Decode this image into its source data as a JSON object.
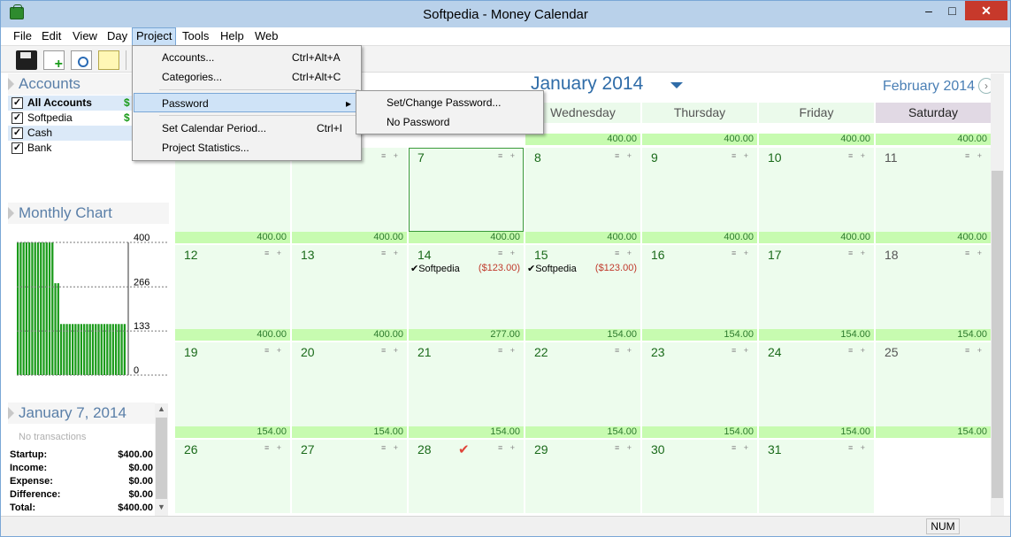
{
  "window": {
    "title": "Softpedia - Money Calendar",
    "min": "–",
    "max": "□",
    "close": "✕"
  },
  "menu": [
    "File",
    "Edit",
    "View",
    "Day",
    "Project",
    "Tools",
    "Help",
    "Web"
  ],
  "project_menu": {
    "items": [
      {
        "label": "Accounts...",
        "shortcut": "Ctrl+Alt+A"
      },
      {
        "label": "Categories...",
        "shortcut": "Ctrl+Alt+C"
      },
      {
        "label": "Password",
        "shortcut": "▸"
      },
      {
        "label": "Set Calendar Period...",
        "shortcut": "Ctrl+I"
      },
      {
        "label": "Project Statistics...",
        "shortcut": ""
      }
    ],
    "password_submenu": [
      "Set/Change Password...",
      "No Password"
    ]
  },
  "accounts": {
    "header": "Accounts",
    "items": [
      {
        "label": "All Accounts",
        "amount": "$",
        "checked": "✓"
      },
      {
        "label": "Softpedia",
        "amount": "$",
        "checked": "✓"
      },
      {
        "label": "Cash",
        "amount": "",
        "checked": "✓"
      },
      {
        "label": "Bank",
        "amount": "",
        "checked": "✓"
      }
    ]
  },
  "monthly_chart": {
    "header": "Monthly Chart",
    "y_ticks": [
      "400",
      "266",
      "133",
      "0"
    ],
    "chart_data": {
      "type": "bar",
      "values": [
        400,
        400,
        400,
        400,
        400,
        400,
        400,
        400,
        400,
        400,
        400,
        400,
        400,
        277,
        277,
        154,
        154,
        154,
        154,
        154,
        154,
        154,
        154,
        154,
        154,
        154,
        154,
        154,
        154,
        154,
        154,
        154,
        154,
        154,
        154,
        154,
        154,
        154
      ],
      "ylim": [
        0,
        400
      ],
      "yticks": [
        400,
        266,
        133,
        0
      ],
      "color": "#1a9b1a"
    }
  },
  "day_detail": {
    "header": "January 7, 2014",
    "no_transactions": "No transactions",
    "rows": [
      {
        "label": "Startup:",
        "value": "$400.00"
      },
      {
        "label": "Income:",
        "value": "$0.00"
      },
      {
        "label": "Expense:",
        "value": "$0.00"
      },
      {
        "label": "Difference:",
        "value": "$0.00"
      },
      {
        "label": "Total:",
        "value": "$400.00"
      }
    ]
  },
  "calendar": {
    "month": "January 2014",
    "next_month": "February 2014",
    "next_icon": "›",
    "days": [
      "Wednesday",
      "Thursday",
      "Friday",
      "Saturday"
    ],
    "week1_balances": [
      "400.00",
      "400.00",
      "400.00",
      "400.00"
    ],
    "weeks": [
      {
        "cells": [
          {
            "num": "",
            "bal": "400.00"
          },
          {
            "num": "",
            "bal": "400.00"
          },
          {
            "num": "7",
            "bal": "400.00"
          },
          {
            "num": "8",
            "bal": "400.00"
          },
          {
            "num": "9",
            "bal": "400.00"
          },
          {
            "num": "10",
            "bal": "400.00"
          },
          {
            "num": "11",
            "bal": "400.00"
          }
        ]
      },
      {
        "cells": [
          {
            "num": "12",
            "bal": "400.00"
          },
          {
            "num": "13",
            "bal": "400.00"
          },
          {
            "num": "14",
            "bal": "277.00",
            "trans_name": "✔Softpedia",
            "trans_amt": "($123.00)"
          },
          {
            "num": "15",
            "bal": "154.00",
            "trans_name": "✔Softpedia",
            "trans_amt": "($123.00)"
          },
          {
            "num": "16",
            "bal": "154.00"
          },
          {
            "num": "17",
            "bal": "154.00"
          },
          {
            "num": "18",
            "bal": "154.00"
          }
        ]
      },
      {
        "cells": [
          {
            "num": "19",
            "bal": "154.00"
          },
          {
            "num": "20",
            "bal": "154.00"
          },
          {
            "num": "21",
            "bal": "154.00"
          },
          {
            "num": "22",
            "bal": "154.00"
          },
          {
            "num": "23",
            "bal": "154.00"
          },
          {
            "num": "24",
            "bal": "154.00"
          },
          {
            "num": "25",
            "bal": "154.00"
          }
        ]
      },
      {
        "cells": [
          {
            "num": "26",
            "bal": ""
          },
          {
            "num": "27",
            "bal": ""
          },
          {
            "num": "28",
            "bal": ""
          },
          {
            "num": "29",
            "bal": ""
          },
          {
            "num": "30",
            "bal": ""
          },
          {
            "num": "31",
            "bal": ""
          },
          {
            "num": "",
            "bal": ""
          }
        ]
      }
    ],
    "cell_icons": "≡ +",
    "today_mark": "✔"
  },
  "status": {
    "num": "NUM"
  },
  "left_scroll": {
    "up": "▲",
    "down": "▼"
  }
}
